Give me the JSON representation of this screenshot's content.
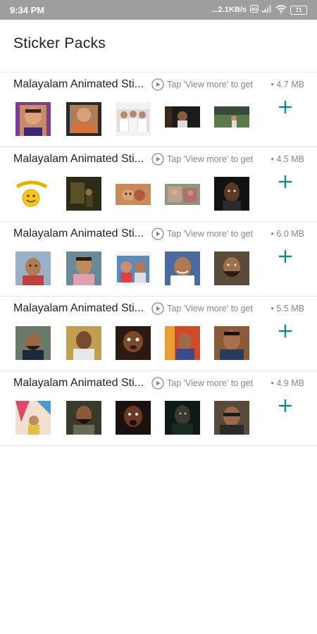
{
  "status_bar": {
    "time": "9:34 PM",
    "network_speed": "...2.1KB/s",
    "battery_level": "71",
    "icons": [
      "data-saver-icon",
      "signal-icon",
      "wifi-icon",
      "battery-icon"
    ]
  },
  "page": {
    "title": "Sticker Packs"
  },
  "colors": {
    "accent": "#128C7E",
    "status_bar_bg": "#9e9e9e",
    "secondary_text": "#888888"
  },
  "packs": [
    {
      "name": "Malayalam Animated Stickers",
      "hint": "Tap 'View more' to get",
      "size": "• 4.7 MB",
      "thumbnails": [
        "sticker-1",
        "sticker-2",
        "sticker-3",
        "sticker-4",
        "sticker-5"
      ]
    },
    {
      "name": "Malayalam Animated Stickers",
      "hint": "Tap 'View more' to get",
      "size": "• 4.5 MB",
      "thumbnails": [
        "sticker-1",
        "sticker-2",
        "sticker-3",
        "sticker-4",
        "sticker-5"
      ]
    },
    {
      "name": "Malayalam Animated Stickers",
      "hint": "Tap 'View more' to get",
      "size": "• 6.0 MB",
      "thumbnails": [
        "sticker-1",
        "sticker-2",
        "sticker-3",
        "sticker-4",
        "sticker-5"
      ]
    },
    {
      "name": "Malayalam Animated Stickers",
      "hint": "Tap 'View more' to get",
      "size": "• 5.5 MB",
      "thumbnails": [
        "sticker-1",
        "sticker-2",
        "sticker-3",
        "sticker-4",
        "sticker-5"
      ]
    },
    {
      "name": "Malayalam Animated Stickers",
      "hint": "Tap 'View more' to get",
      "size": "• 4.9 MB",
      "thumbnails": [
        "sticker-1",
        "sticker-2",
        "sticker-3",
        "sticker-4",
        "sticker-5"
      ]
    }
  ]
}
